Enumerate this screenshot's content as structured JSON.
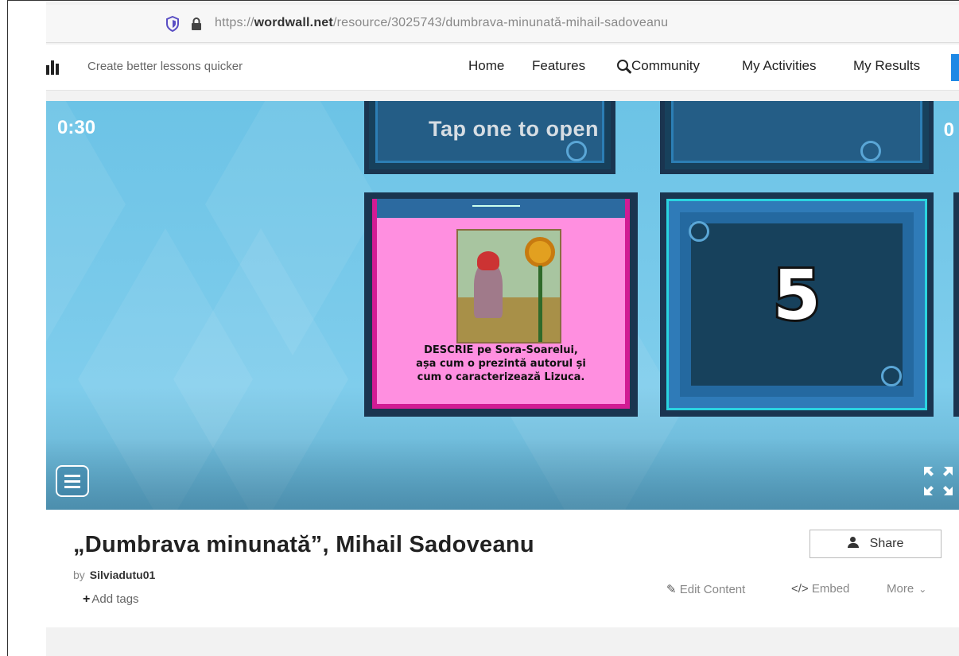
{
  "browser": {
    "url_host": "https://wordwall.net",
    "url_path": "/resource/3025743/dumbrava-minunată-mihail-sadoveanu"
  },
  "nav": {
    "tagline": "Create better lessons quicker",
    "links": [
      "Home",
      "Features",
      "Community",
      "My Activities",
      "My Results"
    ],
    "accent_color": "#1e88e5"
  },
  "game": {
    "timer": "0:30",
    "score": "0",
    "prompt": "Tap one to open",
    "open_card_text": [
      "DESCRIE pe Sora-Soarelui,",
      "așa cum o prezintă autorul și",
      "cum o caracterizează Lizuca."
    ],
    "closed_card_number": "5",
    "colors": {
      "open_card_bg": "#ff8fe0",
      "open_card_border": "#d21b94",
      "card_dark": "#17415c"
    }
  },
  "info": {
    "title": "„Dumbrava minunată”, Mihail Sadoveanu",
    "by_label": "by",
    "author": "Silviadutu01",
    "add_tags": "Add tags",
    "share": "Share",
    "edit_content": "Edit Content",
    "embed": "Embed",
    "more": "More"
  }
}
